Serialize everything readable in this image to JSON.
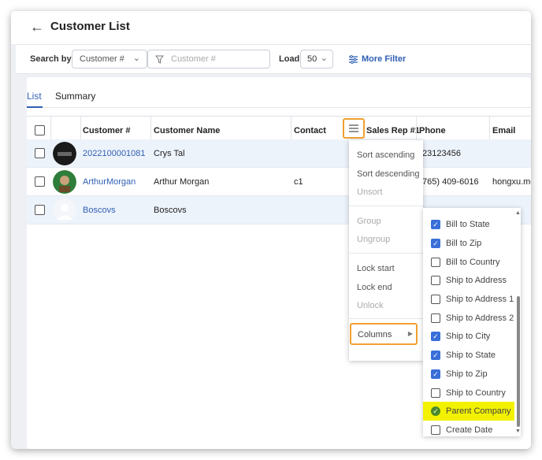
{
  "page": {
    "title": "Customer List",
    "back_icon": "arrow-left-icon"
  },
  "search": {
    "label": "Search by",
    "field": "Customer #",
    "placeholder": "Customer #",
    "load_label": "Load",
    "load_value": "50",
    "more_filter": "More Filter"
  },
  "tabs": [
    {
      "label": "List",
      "active": true
    },
    {
      "label": "Summary",
      "active": false
    }
  ],
  "grid": {
    "columns": [
      "Customer #",
      "Customer Name",
      "Contact",
      "Sales Rep #1",
      "Phone",
      "Email"
    ],
    "rows": [
      {
        "customer_no": "2022100001081",
        "name": "Crys Tal",
        "contact": "",
        "phone": "23123456",
        "email": ""
      },
      {
        "customer_no": "ArthurMorgan",
        "name": "Arthur Morgan",
        "contact": "c1",
        "phone": "765) 409-6016",
        "email": "hongxu.me"
      },
      {
        "customer_no": "Boscovs",
        "name": "Boscovs",
        "contact": "",
        "phone": "",
        "email": ""
      }
    ]
  },
  "column_menu": {
    "sort_ascending": "Sort ascending",
    "sort_descending": "Sort descending",
    "unsort": "Unsort",
    "group": "Group",
    "ungroup": "Ungroup",
    "lock_start": "Lock start",
    "lock_end": "Lock end",
    "unlock": "Unlock",
    "columns": "Columns"
  },
  "columns_list": [
    {
      "label": "Bill to State",
      "checked": true
    },
    {
      "label": "Bill to Zip",
      "checked": true
    },
    {
      "label": "Bill to Country",
      "checked": false
    },
    {
      "label": "Ship to Address",
      "checked": false
    },
    {
      "label": "Ship to Address 1",
      "checked": false
    },
    {
      "label": "Ship to Address 2",
      "checked": false
    },
    {
      "label": "Ship to City",
      "checked": true
    },
    {
      "label": "Ship to State",
      "checked": true
    },
    {
      "label": "Ship to Zip",
      "checked": true
    },
    {
      "label": "Ship to Country",
      "checked": false
    },
    {
      "label": "Parent Company",
      "checked": true,
      "highlighted": true
    },
    {
      "label": "Create Date",
      "checked": false
    }
  ],
  "colors": {
    "accent": "#2f5fb3",
    "highlight_border": "#f0a030",
    "highlight_fill": "#f2f200",
    "checkbox_on": "#3a6fd8"
  }
}
